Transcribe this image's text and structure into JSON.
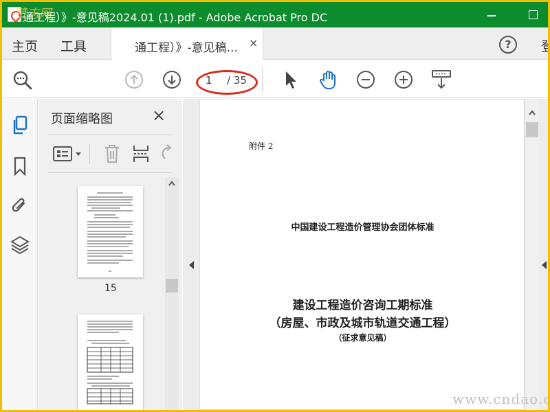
{
  "window": {
    "title": "通工程）》-意见稿2024.01 (1).pdf - Adobe Acrobat Pro DC",
    "watermark_logo": "赞志网"
  },
  "tabs": {
    "home": "主页",
    "tools": "工具",
    "document": "通工程）》-意见稿...",
    "close": "×",
    "login": "登"
  },
  "toolbar": {
    "page_current": "1",
    "page_total": "/ 35",
    "annotation_color": "#d82a1a",
    "icons": [
      "search-zoom-icon",
      "prev-page-icon",
      "next-page-icon",
      "select-pointer-icon",
      "hand-tool-icon",
      "zoom-out-icon",
      "zoom-in-icon",
      "scroll-mode-icon"
    ]
  },
  "rail": {
    "icons": [
      "page-thumbnails-icon",
      "bookmark-icon",
      "attachment-icon",
      "layers-icon"
    ]
  },
  "thumbnails": {
    "title": "页面缩略图",
    "close": "×",
    "pages": [
      {
        "label": "15"
      },
      {
        "label": ""
      }
    ]
  },
  "document": {
    "annex": "附件 2",
    "org": "中国建设工程造价管理协会团体标准",
    "title_line1": "建设工程造价咨询工期标准",
    "title_line2": "（房屋、市政及城市轨道交通工程）",
    "title_line3": "（征求意见稿）"
  },
  "site_watermark": "www.cndao.com",
  "colors": {
    "titlebar": "#0c8c2c",
    "outer_border": "#f0c000",
    "hand_tool_active": "#1a73c8"
  }
}
